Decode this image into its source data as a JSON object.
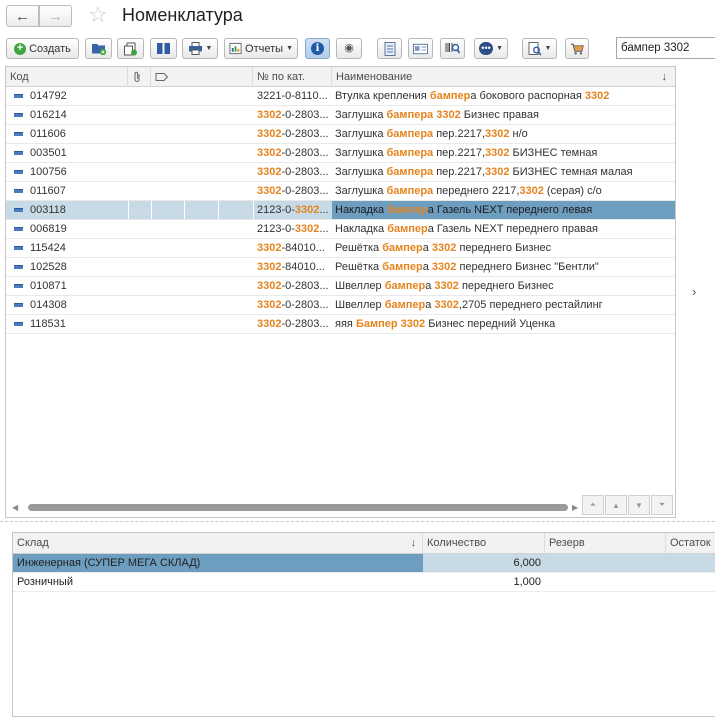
{
  "header": {
    "back_icon": "←",
    "forward_icon": "→",
    "favorite_icon": "☆",
    "title": "Номенклатура"
  },
  "toolbar": {
    "create_label": "Создать",
    "reports_label": "Отчеты",
    "search_value": "бампер 3302",
    "icons": {
      "create": "+",
      "info": "i",
      "eye": "◉",
      "dots": "•••",
      "caret": "▼"
    }
  },
  "table": {
    "columns": {
      "code": "Код",
      "catalog_number": "№ по кат.",
      "name": "Наименование",
      "sort_indicator": "↓"
    },
    "rows": [
      {
        "code": "014792",
        "cat": [
          {
            "t": "3221-0-8110..."
          }
        ],
        "name": [
          {
            "t": "Втулка крепления "
          },
          {
            "t": "бампер",
            "h": 1
          },
          {
            "t": "а бокового распорная "
          },
          {
            "t": "3302",
            "h": 1
          }
        ]
      },
      {
        "code": "016214",
        "cat": [
          {
            "t": "3302",
            "h": 1
          },
          {
            "t": "-0-2803..."
          }
        ],
        "name": [
          {
            "t": "Заглушка "
          },
          {
            "t": "бампера",
            "h": 1
          },
          {
            "t": " "
          },
          {
            "t": "3302",
            "h": 1
          },
          {
            "t": " Бизнес правая"
          }
        ]
      },
      {
        "code": "011606",
        "cat": [
          {
            "t": "3302",
            "h": 1
          },
          {
            "t": "-0-2803..."
          }
        ],
        "name": [
          {
            "t": "Заглушка "
          },
          {
            "t": "бампера",
            "h": 1
          },
          {
            "t": " пер.2217,"
          },
          {
            "t": "3302",
            "h": 1
          },
          {
            "t": " н/о"
          }
        ]
      },
      {
        "code": "003501",
        "cat": [
          {
            "t": "3302",
            "h": 1
          },
          {
            "t": "-0-2803..."
          }
        ],
        "name": [
          {
            "t": "Заглушка "
          },
          {
            "t": "бампера",
            "h": 1
          },
          {
            "t": " пер.2217,"
          },
          {
            "t": "3302",
            "h": 1
          },
          {
            "t": " БИЗНЕС темная"
          }
        ]
      },
      {
        "code": "100756",
        "cat": [
          {
            "t": "3302",
            "h": 1
          },
          {
            "t": "-0-2803..."
          }
        ],
        "name": [
          {
            "t": "Заглушка "
          },
          {
            "t": "бампера",
            "h": 1
          },
          {
            "t": " пер.2217,"
          },
          {
            "t": "3302",
            "h": 1
          },
          {
            "t": " БИЗНЕС темная малая"
          }
        ]
      },
      {
        "code": "011607",
        "cat": [
          {
            "t": "3302",
            "h": 1
          },
          {
            "t": "-0-2803..."
          }
        ],
        "name": [
          {
            "t": "Заглушка "
          },
          {
            "t": "бампера",
            "h": 1
          },
          {
            "t": " переднего 2217,"
          },
          {
            "t": "3302",
            "h": 1
          },
          {
            "t": " (серая) с/о"
          }
        ]
      },
      {
        "code": "003118",
        "cat": [
          {
            "t": "2123-0-"
          },
          {
            "t": "3302",
            "h": 1
          },
          {
            "t": "..."
          }
        ],
        "name": [
          {
            "t": "Накладка "
          },
          {
            "t": "бампер",
            "h": 1
          },
          {
            "t": "а Газель NEXT переднего левая"
          }
        ],
        "selected": true
      },
      {
        "code": "006819",
        "cat": [
          {
            "t": "2123-0-"
          },
          {
            "t": "3302",
            "h": 1
          },
          {
            "t": "..."
          }
        ],
        "name": [
          {
            "t": "Накладка "
          },
          {
            "t": "бампер",
            "h": 1
          },
          {
            "t": "а Газель NEXT переднего правая"
          }
        ]
      },
      {
        "code": "115424",
        "cat": [
          {
            "t": "3302",
            "h": 1
          },
          {
            "t": "-84010..."
          }
        ],
        "name": [
          {
            "t": "Решётка "
          },
          {
            "t": "бампер",
            "h": 1
          },
          {
            "t": "а "
          },
          {
            "t": "3302",
            "h": 1
          },
          {
            "t": " переднего Бизнес"
          }
        ]
      },
      {
        "code": "102528",
        "cat": [
          {
            "t": "3302",
            "h": 1
          },
          {
            "t": "-84010..."
          }
        ],
        "name": [
          {
            "t": "Решётка "
          },
          {
            "t": "бампер",
            "h": 1
          },
          {
            "t": "а "
          },
          {
            "t": "3302",
            "h": 1
          },
          {
            "t": " переднего Бизнес \"Бентли\""
          }
        ]
      },
      {
        "code": "010871",
        "cat": [
          {
            "t": "3302",
            "h": 1
          },
          {
            "t": "-0-2803..."
          }
        ],
        "name": [
          {
            "t": "Швеллер "
          },
          {
            "t": "бампер",
            "h": 1
          },
          {
            "t": "а "
          },
          {
            "t": "3302",
            "h": 1
          },
          {
            "t": " переднего Бизнес"
          }
        ]
      },
      {
        "code": "014308",
        "cat": [
          {
            "t": "3302",
            "h": 1
          },
          {
            "t": "-0-2803..."
          }
        ],
        "name": [
          {
            "t": "Швеллер "
          },
          {
            "t": "бампер",
            "h": 1
          },
          {
            "t": "а "
          },
          {
            "t": "3302",
            "h": 1
          },
          {
            "t": ",2705 переднего рестайлинг"
          }
        ]
      },
      {
        "code": "118531",
        "cat": [
          {
            "t": "3302",
            "h": 1
          },
          {
            "t": "-0-2803..."
          }
        ],
        "name": [
          {
            "t": "яяя "
          },
          {
            "t": "Бампер",
            "h": 1
          },
          {
            "t": " "
          },
          {
            "t": "3302",
            "h": 1
          },
          {
            "t": " Бизнес передний Уценка"
          }
        ]
      }
    ]
  },
  "side_arrow": "›",
  "scroll_icons": {
    "left": "◀",
    "right": "▶",
    "first": "⏶",
    "up": "▲",
    "down": "▼",
    "last": "⏷"
  },
  "stock_table": {
    "columns": {
      "warehouse": "Склад",
      "sort_indicator": "↓",
      "quantity": "Количество",
      "reserve": "Резерв",
      "remainder": "Остаток"
    },
    "rows": [
      {
        "warehouse": "Инженерная (СУПЕР МЕГА СКЛАД)",
        "quantity": "6,000",
        "reserve": "",
        "remainder": "",
        "selected": true
      },
      {
        "warehouse": "Розничный",
        "quantity": "1,000",
        "reserve": "",
        "remainder": ""
      }
    ]
  }
}
